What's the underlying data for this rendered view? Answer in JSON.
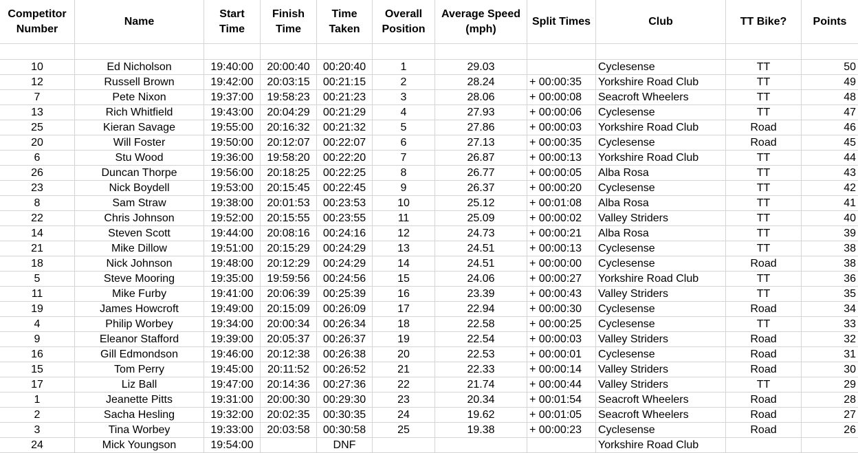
{
  "sheet": {
    "headers": [
      "Competitor Number",
      "Name",
      "Start Time",
      "Finish Time",
      "Time Taken",
      "Overall Position",
      "Average Speed (mph)",
      "Split Times",
      "Club",
      "TT Bike?",
      "Points"
    ],
    "rows": [
      {
        "number": "10",
        "name": "Ed Nicholson",
        "start": "19:40:00",
        "finish": "20:00:40",
        "taken": "00:20:40",
        "position": "1",
        "speed": "29.03",
        "split": "",
        "club": "Cyclesense",
        "bike": "TT",
        "points": "50"
      },
      {
        "number": "12",
        "name": "Russell Brown",
        "start": "19:42:00",
        "finish": "20:03:15",
        "taken": "00:21:15",
        "position": "2",
        "speed": "28.24",
        "split": "+ 00:00:35",
        "club": "Yorkshire Road Club",
        "bike": "TT",
        "points": "49"
      },
      {
        "number": "7",
        "name": "Pete Nixon",
        "start": "19:37:00",
        "finish": "19:58:23",
        "taken": "00:21:23",
        "position": "3",
        "speed": "28.06",
        "split": "+ 00:00:08",
        "club": "Seacroft Wheelers",
        "bike": "TT",
        "points": "48"
      },
      {
        "number": "13",
        "name": "Rich Whitfield",
        "start": "19:43:00",
        "finish": "20:04:29",
        "taken": "00:21:29",
        "position": "4",
        "speed": "27.93",
        "split": "+ 00:00:06",
        "club": "Cyclesense",
        "bike": "TT",
        "points": "47"
      },
      {
        "number": "25",
        "name": "Kieran Savage",
        "start": "19:55:00",
        "finish": "20:16:32",
        "taken": "00:21:32",
        "position": "5",
        "speed": "27.86",
        "split": "+ 00:00:03",
        "club": "Yorkshire Road Club",
        "bike": "Road",
        "points": "46"
      },
      {
        "number": "20",
        "name": "Will Foster",
        "start": "19:50:00",
        "finish": "20:12:07",
        "taken": "00:22:07",
        "position": "6",
        "speed": "27.13",
        "split": "+ 00:00:35",
        "club": "Cyclesense",
        "bike": "Road",
        "points": "45"
      },
      {
        "number": "6",
        "name": "Stu Wood",
        "start": "19:36:00",
        "finish": "19:58:20",
        "taken": "00:22:20",
        "position": "7",
        "speed": "26.87",
        "split": "+ 00:00:13",
        "club": "Yorkshire Road Club",
        "bike": "TT",
        "points": "44"
      },
      {
        "number": "26",
        "name": "Duncan Thorpe",
        "start": "19:56:00",
        "finish": "20:18:25",
        "taken": "00:22:25",
        "position": "8",
        "speed": "26.77",
        "split": "+ 00:00:05",
        "club": "Alba Rosa",
        "bike": "TT",
        "points": "43"
      },
      {
        "number": "23",
        "name": "Nick Boydell",
        "start": "19:53:00",
        "finish": "20:15:45",
        "taken": "00:22:45",
        "position": "9",
        "speed": "26.37",
        "split": "+ 00:00:20",
        "club": "Cyclesense",
        "bike": "TT",
        "points": "42"
      },
      {
        "number": "8",
        "name": "Sam Straw",
        "start": "19:38:00",
        "finish": "20:01:53",
        "taken": "00:23:53",
        "position": "10",
        "speed": "25.12",
        "split": "+ 00:01:08",
        "club": "Alba Rosa",
        "bike": "TT",
        "points": "41"
      },
      {
        "number": "22",
        "name": "Chris Johnson",
        "start": "19:52:00",
        "finish": "20:15:55",
        "taken": "00:23:55",
        "position": "11",
        "speed": "25.09",
        "split": "+ 00:00:02",
        "club": "Valley Striders",
        "bike": "TT",
        "points": "40"
      },
      {
        "number": "14",
        "name": "Steven Scott",
        "start": "19:44:00",
        "finish": "20:08:16",
        "taken": "00:24:16",
        "position": "12",
        "speed": "24.73",
        "split": "+ 00:00:21",
        "club": "Alba Rosa",
        "bike": "TT",
        "points": "39"
      },
      {
        "number": "21",
        "name": "Mike Dillow",
        "start": "19:51:00",
        "finish": "20:15:29",
        "taken": "00:24:29",
        "position": "13",
        "speed": "24.51",
        "split": "+ 00:00:13",
        "club": "Cyclesense",
        "bike": "TT",
        "points": "38"
      },
      {
        "number": "18",
        "name": "Nick Johnson",
        "start": "19:48:00",
        "finish": "20:12:29",
        "taken": "00:24:29",
        "position": "14",
        "speed": "24.51",
        "split": "+ 00:00:00",
        "club": "Cyclesense",
        "bike": "Road",
        "points": "38"
      },
      {
        "number": "5",
        "name": "Steve Mooring",
        "start": "19:35:00",
        "finish": "19:59:56",
        "taken": "00:24:56",
        "position": "15",
        "speed": "24.06",
        "split": "+ 00:00:27",
        "club": "Yorkshire Road Club",
        "bike": "TT",
        "points": "36"
      },
      {
        "number": "11",
        "name": "Mike Furby",
        "start": "19:41:00",
        "finish": "20:06:39",
        "taken": "00:25:39",
        "position": "16",
        "speed": "23.39",
        "split": "+ 00:00:43",
        "club": "Valley Striders",
        "bike": "TT",
        "points": "35"
      },
      {
        "number": "19",
        "name": "James Howcroft",
        "start": "19:49:00",
        "finish": "20:15:09",
        "taken": "00:26:09",
        "position": "17",
        "speed": "22.94",
        "split": "+ 00:00:30",
        "club": "Cyclesense",
        "bike": "Road",
        "points": "34"
      },
      {
        "number": "4",
        "name": "Philip Worbey",
        "start": "19:34:00",
        "finish": "20:00:34",
        "taken": "00:26:34",
        "position": "18",
        "speed": "22.58",
        "split": "+ 00:00:25",
        "club": "Cyclesense",
        "bike": "TT",
        "points": "33"
      },
      {
        "number": "9",
        "name": "Eleanor Stafford",
        "start": "19:39:00",
        "finish": "20:05:37",
        "taken": "00:26:37",
        "position": "19",
        "speed": "22.54",
        "split": "+ 00:00:03",
        "club": "Valley Striders",
        "bike": "Road",
        "points": "32"
      },
      {
        "number": "16",
        "name": "Gill Edmondson",
        "start": "19:46:00",
        "finish": "20:12:38",
        "taken": "00:26:38",
        "position": "20",
        "speed": "22.53",
        "split": "+ 00:00:01",
        "club": "Cyclesense",
        "bike": "Road",
        "points": "31"
      },
      {
        "number": "15",
        "name": "Tom Perry",
        "start": "19:45:00",
        "finish": "20:11:52",
        "taken": "00:26:52",
        "position": "21",
        "speed": "22.33",
        "split": "+ 00:00:14",
        "club": "Valley Striders",
        "bike": "Road",
        "points": "30"
      },
      {
        "number": "17",
        "name": "Liz Ball",
        "start": "19:47:00",
        "finish": "20:14:36",
        "taken": "00:27:36",
        "position": "22",
        "speed": "21.74",
        "split": "+ 00:00:44",
        "club": "Valley Striders",
        "bike": "TT",
        "points": "29"
      },
      {
        "number": "1",
        "name": "Jeanette Pitts",
        "start": "19:31:00",
        "finish": "20:00:30",
        "taken": "00:29:30",
        "position": "23",
        "speed": "20.34",
        "split": "+ 00:01:54",
        "club": "Seacroft Wheelers",
        "bike": "Road",
        "points": "28"
      },
      {
        "number": "2",
        "name": "Sacha Hesling",
        "start": "19:32:00",
        "finish": "20:02:35",
        "taken": "00:30:35",
        "position": "24",
        "speed": "19.62",
        "split": "+ 00:01:05",
        "club": "Seacroft Wheelers",
        "bike": "Road",
        "points": "27"
      },
      {
        "number": "3",
        "name": "Tina Worbey",
        "start": "19:33:00",
        "finish": "20:03:58",
        "taken": "00:30:58",
        "position": "25",
        "speed": "19.38",
        "split": "+ 00:00:23",
        "club": "Cyclesense",
        "bike": "Road",
        "points": "26"
      },
      {
        "number": "24",
        "name": "Mick Youngson",
        "start": "19:54:00",
        "finish": "",
        "taken": "DNF",
        "position": "",
        "speed": "",
        "split": "",
        "club": "Yorkshire Road Club",
        "bike": "",
        "points": ""
      }
    ]
  }
}
